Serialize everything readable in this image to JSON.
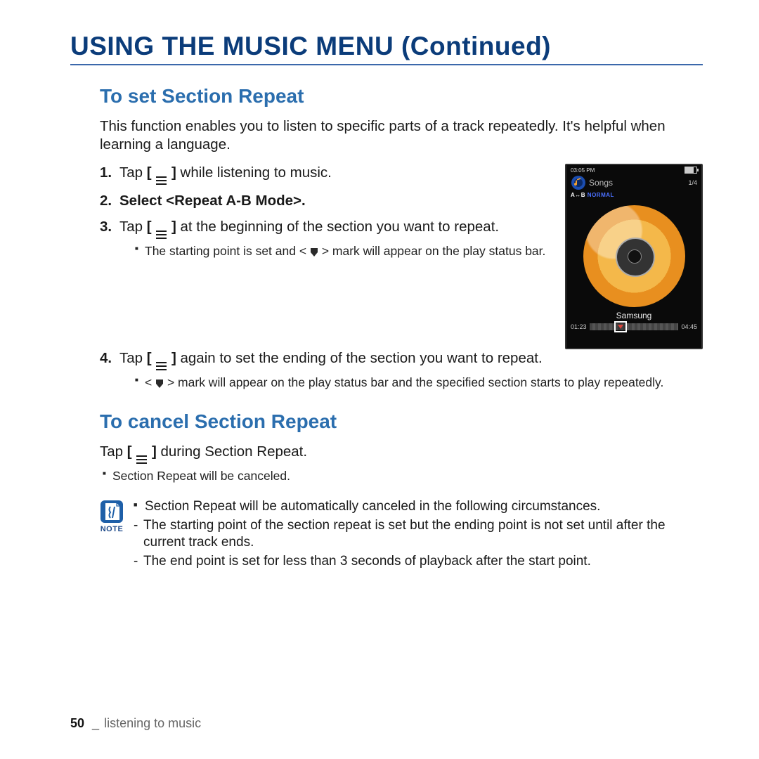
{
  "title": "USING THE MUSIC MENU (Continued)",
  "section1": {
    "heading": "To set Section Repeat",
    "intro": "This function enables you to listen to specific parts of a track repeatedly. It's helpful when learning a language.",
    "steps": {
      "s1_a": "Tap ",
      "s1_b": " while listening to music.",
      "s2": "Select <Repeat A-B Mode>.",
      "s3_a": "Tap ",
      "s3_b": " at the beginning of the section you want to repeat.",
      "s3_sub_a": "The starting point is set and < ",
      "s3_sub_b": " > mark will appear on the play status bar.",
      "s4_a": "Tap ",
      "s4_b": " again to set the ending of the section you want to repeat.",
      "s4_sub_a": "< ",
      "s4_sub_b": " > mark will appear on the play status bar and the specified section starts to play repeatedly."
    }
  },
  "section2": {
    "heading": "To cancel Section Repeat",
    "line_a": "Tap ",
    "line_b": " during Section Repeat.",
    "sub": "Section Repeat will be canceled."
  },
  "note": {
    "label": "NOTE",
    "main": "Section Repeat will be automatically canceled in the following circumstances.",
    "d1": "The starting point of the section repeat is set but the ending point is not set until after the current track ends.",
    "d2": "The end point is set for less than 3 seconds of playback after the start point."
  },
  "device": {
    "clock": "03:05 PM",
    "count": "1/4",
    "screen_title": "Songs",
    "mode_ab": "A↔B",
    "mode_normal": "NORMAL",
    "track": "Samsung",
    "time_elapsed": "01:23",
    "time_total": "04:45"
  },
  "footer": {
    "page": "50",
    "chapter": "listening to music"
  }
}
